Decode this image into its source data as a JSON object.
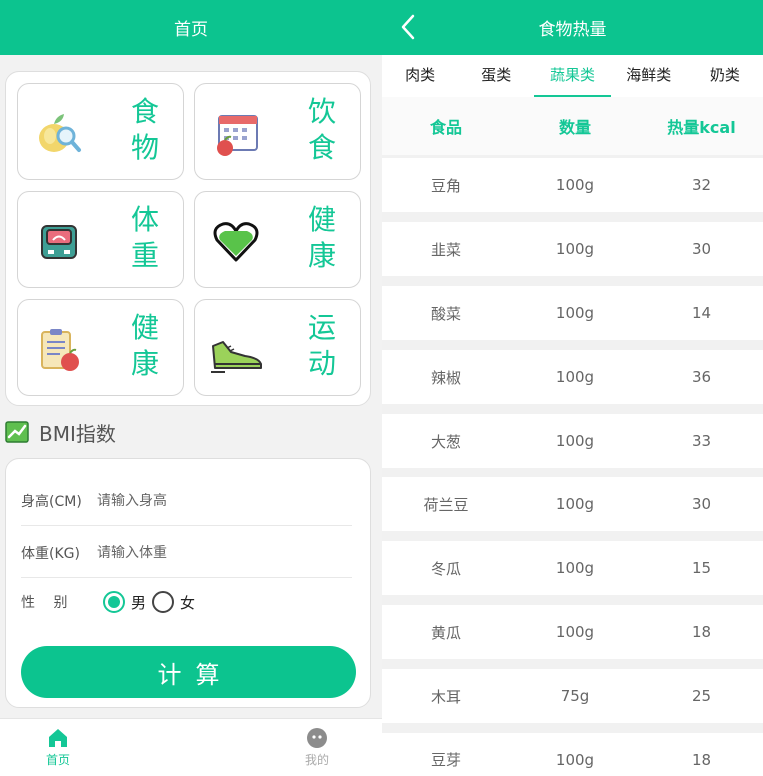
{
  "home": {
    "title": "首页",
    "tiles": [
      "食物",
      "饮食",
      "体重",
      "健康",
      "健康",
      "运动"
    ],
    "bmi": {
      "heading": "BMI指数",
      "height_label": "身高(CM)",
      "height_placeholder": "请输入身高",
      "weight_label": "体重(KG)",
      "weight_placeholder": "请输入体重",
      "gender_label": "性　 别",
      "gender_options": [
        "男",
        "女"
      ],
      "selected_gender": "男",
      "calc_button": "计算"
    },
    "tabbar": {
      "home": "首页",
      "mine": "我的",
      "active": "首页"
    }
  },
  "food": {
    "title": "食物热量",
    "categories": [
      "肉类",
      "蛋类",
      "蔬果类",
      "海鲜类",
      "奶类"
    ],
    "active_category": "蔬果类",
    "columns": [
      "食品",
      "数量",
      "热量kcal"
    ],
    "rows": [
      [
        "豆角",
        "100g",
        "32"
      ],
      [
        "韭菜",
        "100g",
        "30"
      ],
      [
        "酸菜",
        "100g",
        "14"
      ],
      [
        "辣椒",
        "100g",
        "36"
      ],
      [
        "大葱",
        "100g",
        "33"
      ],
      [
        "荷兰豆",
        "100g",
        "30"
      ],
      [
        "冬瓜",
        "100g",
        "15"
      ],
      [
        "黄瓜",
        "100g",
        "18"
      ],
      [
        "木耳",
        "75g",
        "25"
      ],
      [
        "豆芽",
        "100g",
        "18"
      ]
    ]
  },
  "colors": {
    "accent": "#0cc48f",
    "label": "#14c796",
    "text": "#666666"
  },
  "icons": {
    "tiles": [
      "fruit-magnifier-icon",
      "calendar-apple-icon",
      "scale-icon",
      "heart-icon",
      "clipboard-apple-icon",
      "sneaker-icon"
    ],
    "bmi": "chart-icon",
    "tabbar": [
      "home-icon",
      "profile-face-icon"
    ],
    "back": "chevron-left-icon"
  }
}
